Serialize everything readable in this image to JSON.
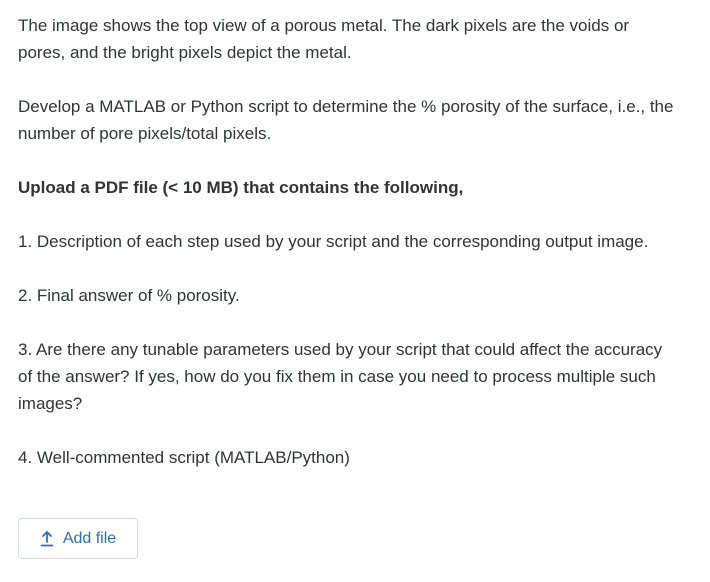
{
  "prompt": {
    "intro": "The image shows the top view of a porous metal. The dark pixels are the voids or pores, and the bright pixels depict the metal.",
    "task": "Develop a MATLAB or Python script to determine the % porosity of the surface, i.e., the number of pore pixels/total pixels.",
    "upload_heading": "Upload a PDF file (< 10 MB) that contains the following,",
    "items": [
      "1. Description of each step used by your script and the corresponding output image.",
      "2. Final answer of % porosity.",
      "3. Are there any tunable parameters used by your script that could affect the accuracy of the answer? If yes, how do you fix them in case you need to process multiple such images?",
      "4. Well-commented script (MATLAB/Python)"
    ]
  },
  "upload": {
    "button_label": "Add file",
    "icon": "upload-icon",
    "accent_color": "#2e6fb7"
  }
}
